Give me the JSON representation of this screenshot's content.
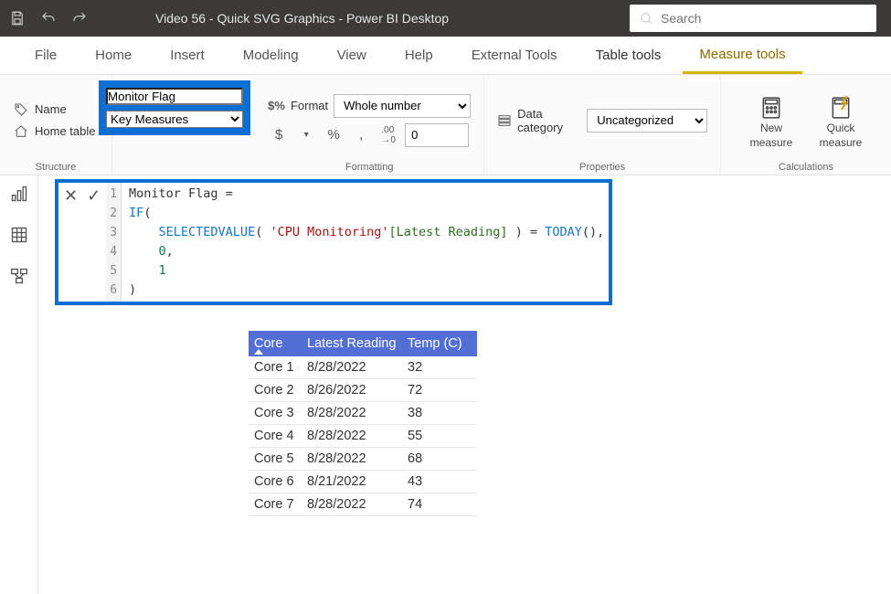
{
  "titlebar": {
    "title": "Video 56 - Quick SVG Graphics - Power BI Desktop",
    "search_placeholder": "Search"
  },
  "ribbon": {
    "tabs": [
      "File",
      "Home",
      "Insert",
      "Modeling",
      "View",
      "Help",
      "External Tools",
      "Table tools",
      "Measure tools"
    ],
    "active_index": 8
  },
  "structure": {
    "name_label": "Name",
    "name_value": "Monitor Flag",
    "home_table_label": "Home table",
    "home_table_value": "Key Measures",
    "group_label": "Structure"
  },
  "formatting": {
    "format_label": "Format",
    "format_value": "Whole number",
    "decimals_value": "0",
    "group_label": "Formatting",
    "currency": "$",
    "percent": "%",
    "comma": ",",
    "inc_dec": ".00→"
  },
  "properties": {
    "data_category_label": "Data category",
    "data_category_value": "Uncategorized",
    "group_label": "Properties"
  },
  "calculations": {
    "new_measure_l1": "New",
    "new_measure_l2": "measure",
    "quick_measure_l1": "Quick",
    "quick_measure_l2": "measure",
    "group_label": "Calculations"
  },
  "formula": {
    "line_numbers": [
      "1",
      "2",
      "3",
      "4",
      "5",
      "6"
    ],
    "l1_name": "Monitor Flag",
    "l1_eq": " =",
    "l2_if": "IF",
    "l2_paren": "(",
    "l3_fn": "SELECTEDVALUE",
    "l3_open": "( ",
    "l3_tbl": "'CPU Monitoring'",
    "l3_col": "[Latest Reading]",
    "l3_close": " ) = ",
    "l3_today": "TODAY",
    "l3_tail": "(),",
    "l4_zero": "0",
    "l4_comma": ",",
    "l5_one": "1",
    "l6_close": ")"
  },
  "table": {
    "headers": {
      "core": "Core",
      "latest": "Latest Reading",
      "temp": "Temp (C)"
    },
    "rows": [
      {
        "core": "Core 1",
        "latest": "8/28/2022",
        "temp": "32"
      },
      {
        "core": "Core 2",
        "latest": "8/26/2022",
        "temp": "72"
      },
      {
        "core": "Core 3",
        "latest": "8/28/2022",
        "temp": "38"
      },
      {
        "core": "Core 4",
        "latest": "8/28/2022",
        "temp": "55"
      },
      {
        "core": "Core 5",
        "latest": "8/28/2022",
        "temp": "68"
      },
      {
        "core": "Core 6",
        "latest": "8/21/2022",
        "temp": "43"
      },
      {
        "core": "Core 7",
        "latest": "8/28/2022",
        "temp": "74"
      }
    ]
  },
  "chart_data": {
    "type": "table",
    "title": "CPU Monitoring",
    "columns": [
      "Core",
      "Latest Reading",
      "Temp (C)"
    ],
    "rows": [
      [
        "Core 1",
        "8/28/2022",
        32
      ],
      [
        "Core 2",
        "8/26/2022",
        72
      ],
      [
        "Core 3",
        "8/28/2022",
        38
      ],
      [
        "Core 4",
        "8/28/2022",
        55
      ],
      [
        "Core 5",
        "8/28/2022",
        68
      ],
      [
        "Core 6",
        "8/21/2022",
        43
      ],
      [
        "Core 7",
        "8/28/2022",
        74
      ]
    ]
  }
}
